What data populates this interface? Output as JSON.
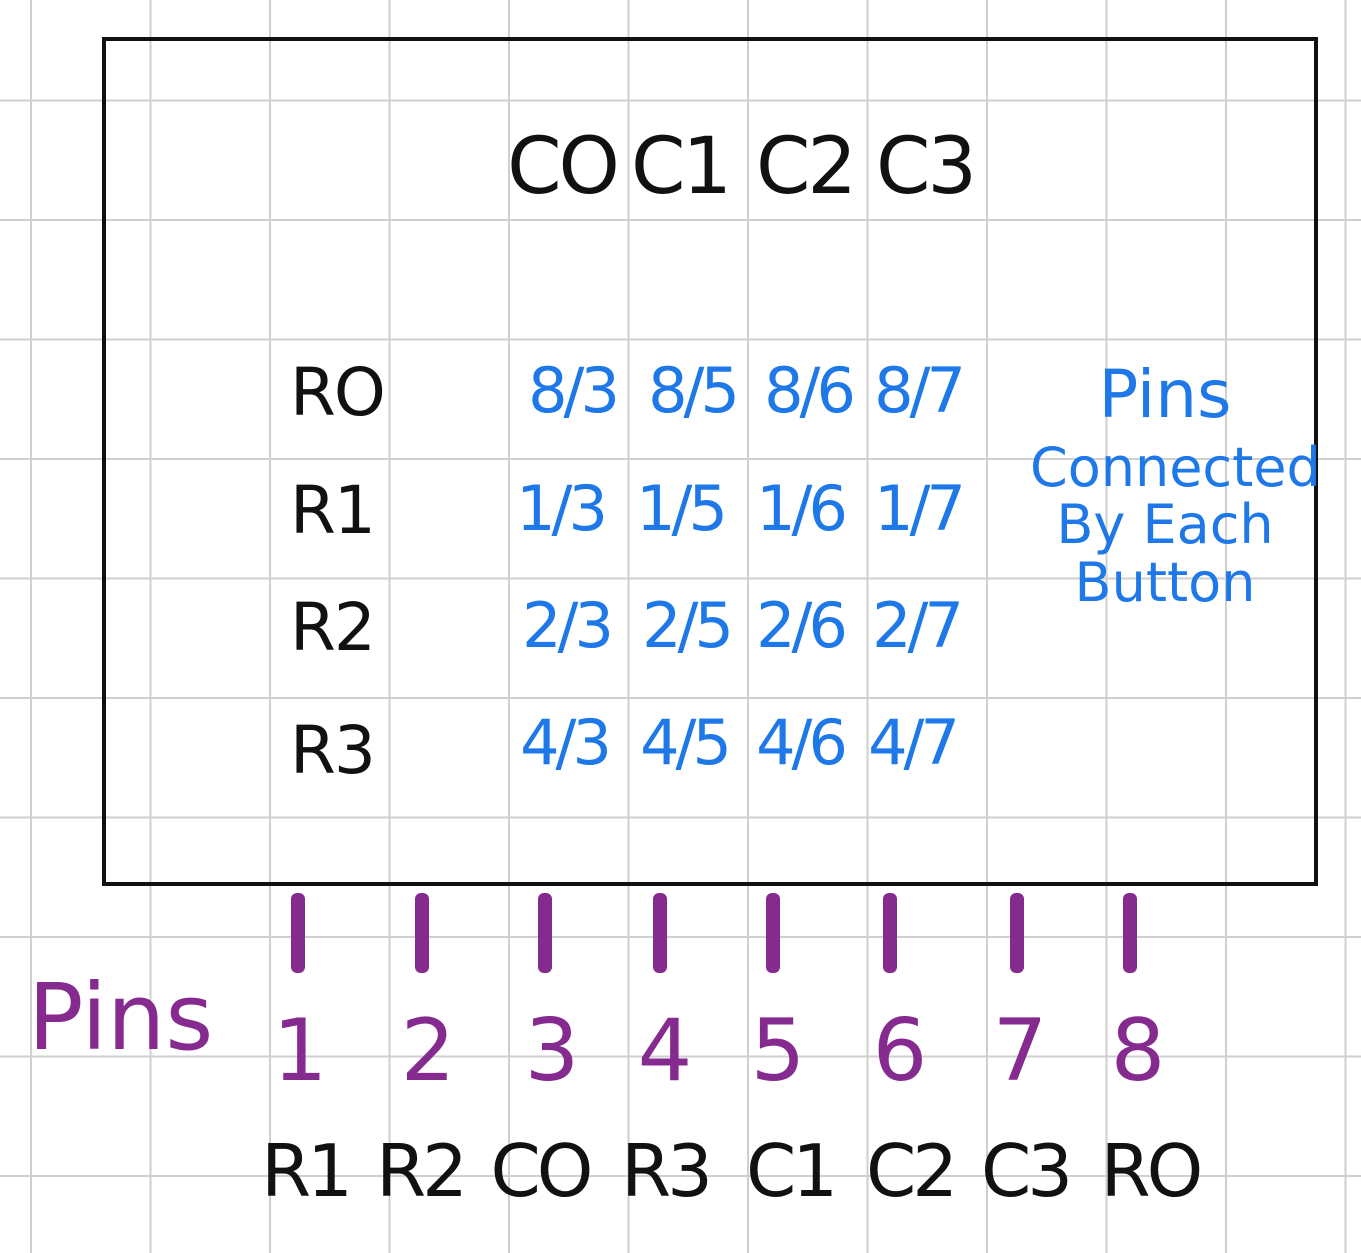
{
  "matrix": {
    "columns": [
      "CO",
      "C1",
      "C2",
      "C3"
    ],
    "rows": [
      {
        "label": "RO",
        "cells": [
          "8/3",
          "8/5",
          "8/6",
          "8/7"
        ]
      },
      {
        "label": "R1",
        "cells": [
          "1/3",
          "1/5",
          "1/6",
          "1/7"
        ]
      },
      {
        "label": "R2",
        "cells": [
          "2/3",
          "2/5",
          "2/6",
          "2/7"
        ]
      },
      {
        "label": "R3",
        "cells": [
          "4/3",
          "4/5",
          "4/6",
          "4/7"
        ]
      }
    ]
  },
  "note": {
    "title": "Pins",
    "line1": "Connected",
    "line2": "By Each",
    "line3": "Button"
  },
  "pins": {
    "label": "Pins",
    "numbers": [
      "1",
      "2",
      "3",
      "4",
      "5",
      "6",
      "7",
      "8"
    ],
    "names": [
      "R1",
      "R2",
      "CO",
      "R3",
      "C1",
      "C2",
      "C3",
      "RO"
    ]
  },
  "colors": {
    "ink": "#111111",
    "blue_notes": "#1e78e8",
    "purple_pins": "#852b8f",
    "grid": "#cfcfcf"
  }
}
